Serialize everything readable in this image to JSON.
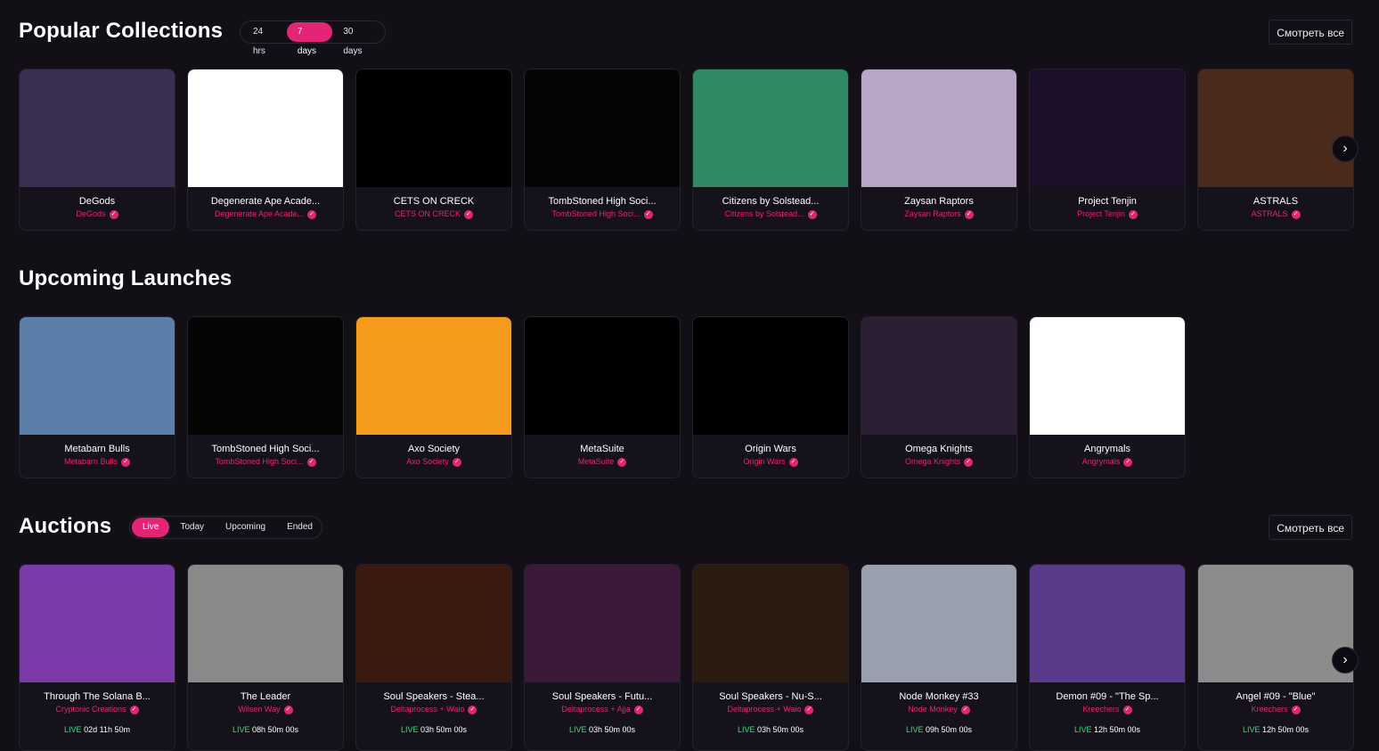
{
  "popular": {
    "title": "Popular Collections",
    "filters": [
      "24 hrs",
      "7 days",
      "30 days"
    ],
    "active_filter": "7 days",
    "see_all": "Смотреть все",
    "cards": [
      {
        "name": "DeGods",
        "sub": "DeGods",
        "bg": "#3b2f52"
      },
      {
        "name": "Degenerate Ape Acade...",
        "sub": "Degenerate Ape Acade...",
        "bg": "#ffffff"
      },
      {
        "name": "CETS ON CRECK",
        "sub": "CETS ON CRECK",
        "bg": "#000000"
      },
      {
        "name": "TombStoned High Soci...",
        "sub": "TombStoned High Soci...",
        "bg": "#050505"
      },
      {
        "name": "Citizens by Solstead...",
        "sub": "Citizens by Solstead...",
        "bg": "#2e8a63"
      },
      {
        "name": "Zaysan Raptors",
        "sub": "Zaysan Raptors",
        "bg": "#b9a6c4"
      },
      {
        "name": "Project Tenjin",
        "sub": "Project Tenjin",
        "bg": "#1b0f2a"
      },
      {
        "name": "ASTRALS",
        "sub": "ASTRALS",
        "bg": "#4a2a1a"
      }
    ]
  },
  "upcoming": {
    "title": "Upcoming Launches",
    "cards": [
      {
        "name": "Metabarn Bulls",
        "sub": "Metabarn Bulls",
        "bg": "#5b7fa8"
      },
      {
        "name": "TombStoned High Soci...",
        "sub": "TombStoned High Soci...",
        "bg": "#050505"
      },
      {
        "name": "Axo Society",
        "sub": "Axo Society",
        "bg": "#f49a1c"
      },
      {
        "name": "MetaSuite",
        "sub": "MetaSuite",
        "bg": "#000000"
      },
      {
        "name": "Origin Wars",
        "sub": "Origin Wars",
        "bg": "#000000"
      },
      {
        "name": "Omega Knights",
        "sub": "Omega Knights",
        "bg": "#2a1f33"
      },
      {
        "name": "Angrymals",
        "sub": "Angrymals",
        "bg": "#ffffff"
      }
    ]
  },
  "auctions": {
    "title": "Auctions",
    "filters": [
      "Live",
      "Today",
      "Upcoming",
      "Ended"
    ],
    "active_filter": "Live",
    "see_all": "Смотреть все",
    "live_label": "LIVE",
    "cards": [
      {
        "name": "Through The Solana B...",
        "sub": "Cryptonic Creations",
        "time": "02d 11h 50m",
        "bg": "#7a3aa8"
      },
      {
        "name": "The Leader",
        "sub": "Wilsen Way",
        "time": "08h 50m 00s",
        "bg": "#8a8a8a"
      },
      {
        "name": "Soul Speakers - Stea...",
        "sub": "Deltaprocess + Waio",
        "time": "03h 50m 00s",
        "bg": "#3a1a10"
      },
      {
        "name": "Soul Speakers - Futu...",
        "sub": "Deltaprocess + Ajja",
        "time": "03h 50m 00s",
        "bg": "#3a1838"
      },
      {
        "name": "Soul Speakers - Nu-S...",
        "sub": "Deltaprocess + Waio",
        "time": "03h 50m 00s",
        "bg": "#2a1a10"
      },
      {
        "name": "Node Monkey #33",
        "sub": "Node Monkey",
        "time": "09h 50m 00s",
        "bg": "#9aa0b0"
      },
      {
        "name": "Demon #09 - \"The Sp...",
        "sub": "Kreechers",
        "time": "12h 50m 00s",
        "bg": "#5a3a8a"
      },
      {
        "name": "Angel #09 - \"Blue\"",
        "sub": "Kreechers",
        "time": "12h 50m 00s",
        "bg": "#8c8c8c"
      }
    ]
  }
}
